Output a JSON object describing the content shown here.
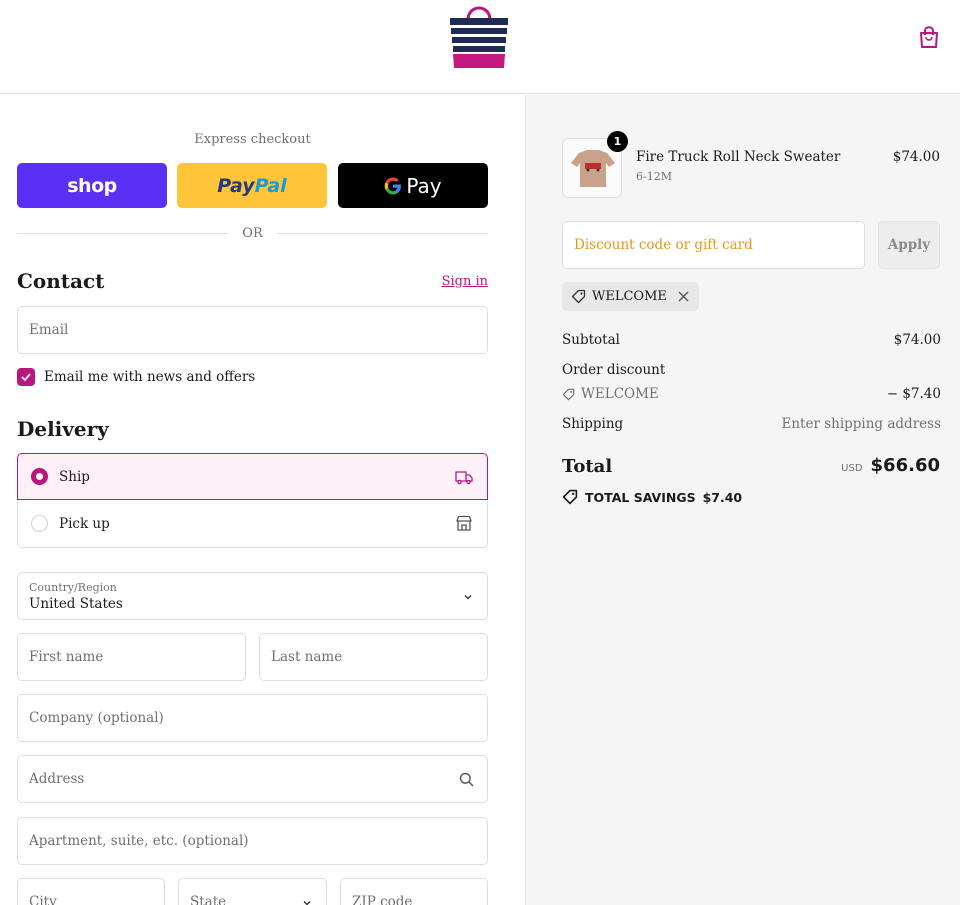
{
  "header": {
    "logo_icon": "tote-bag-logo",
    "cart_icon": "shopping-bag-icon"
  },
  "express": {
    "label": "Express checkout",
    "shop_pay": "shop",
    "paypal_1": "Pay",
    "paypal_2": "Pal",
    "gpay": "Pay",
    "or": "OR"
  },
  "contact": {
    "title": "Contact",
    "sign_in": "Sign in",
    "email_placeholder": "Email",
    "newsletter_label": "Email me with news and offers",
    "newsletter_checked": true
  },
  "delivery": {
    "title": "Delivery",
    "options": [
      {
        "label": "Ship",
        "selected": true,
        "icon": "truck-icon"
      },
      {
        "label": "Pick up",
        "selected": false,
        "icon": "store-icon"
      }
    ],
    "country_label": "Country/Region",
    "country_value": "United States",
    "first_name": "First name",
    "last_name": "Last name",
    "company": "Company (optional)",
    "address": "Address",
    "apartment": "Apartment, suite, etc. (optional)",
    "city": "City",
    "state": "State",
    "zip": "ZIP code"
  },
  "summary": {
    "product": {
      "name": "Fire Truck Roll Neck Sweater",
      "variant": "6-12M",
      "price": "$74.00",
      "quantity": "1"
    },
    "discount_placeholder": "Discount code or gift card",
    "apply": "Apply",
    "applied_code": "WELCOME",
    "subtotal_label": "Subtotal",
    "subtotal_value": "$74.00",
    "order_discount_label": "Order discount",
    "discount_code": "WELCOME",
    "discount_value": "− $7.40",
    "shipping_label": "Shipping",
    "shipping_value": "Enter shipping address",
    "total_label": "Total",
    "currency": "USD",
    "total_value": "$66.60",
    "savings_label": "TOTAL SAVINGS",
    "savings_value": "$7.40"
  },
  "colors": {
    "accent": "#b7177f",
    "shop_pay": "#5a31f4",
    "paypal": "#ffc439",
    "gpay": "#000000"
  }
}
